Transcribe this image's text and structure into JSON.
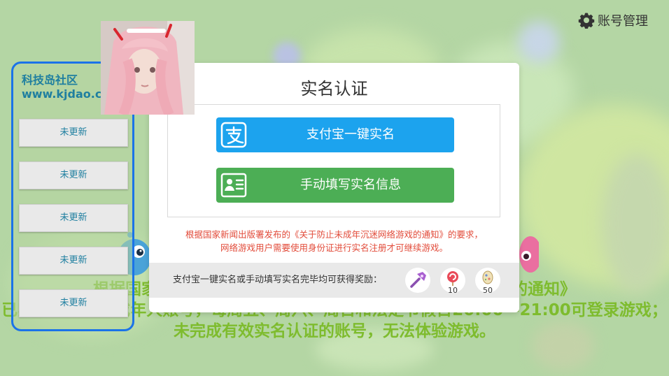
{
  "account": {
    "icon": "gear-icon",
    "label": "账号管理"
  },
  "announcement": {
    "line1": "根据国家新闻出版署发布的《关于防止未成年沉迷网络游戏的通知》",
    "line2": "已实名认证的未成年人账号，每周五、周六、周日和法定节假日20:00—21:00可登录游戏；",
    "line3": "未完成有效实名认证的账号，无法体验游戏。"
  },
  "modal": {
    "title": "实名认证",
    "alipay_button": {
      "icon": "alipay-icon",
      "label": "支付宝一键实名"
    },
    "manual_button": {
      "icon": "id-card-icon",
      "label": "手动填写实名信息"
    },
    "notice_line1": "根据国家新闻出版署发布的《关于防止未成年沉迷网络游戏的通知》的要求，",
    "notice_line2": "网络游戏用户需要使用身份证进行实名注册才可继续游戏。",
    "reward_text": "支付宝一键实名或手动填写实名完毕均可获得奖励：",
    "rewards": [
      {
        "icon": "hammer-icon",
        "count": ""
      },
      {
        "icon": "lollipop-icon",
        "count": "10"
      },
      {
        "icon": "egg-icon",
        "count": "50"
      }
    ]
  },
  "side_panel": {
    "title_line1": "科技岛社区",
    "title_line2": "www.kjdao.cc",
    "buttons": [
      "未更新",
      "未更新",
      "未更新",
      "未更新",
      "未更新"
    ]
  },
  "colors": {
    "alipay": "#1ca3ee",
    "manual": "#4cae55",
    "notice": "#e24b3a",
    "announcement": "#7ebc2e",
    "panel_border": "#1b73e8"
  }
}
